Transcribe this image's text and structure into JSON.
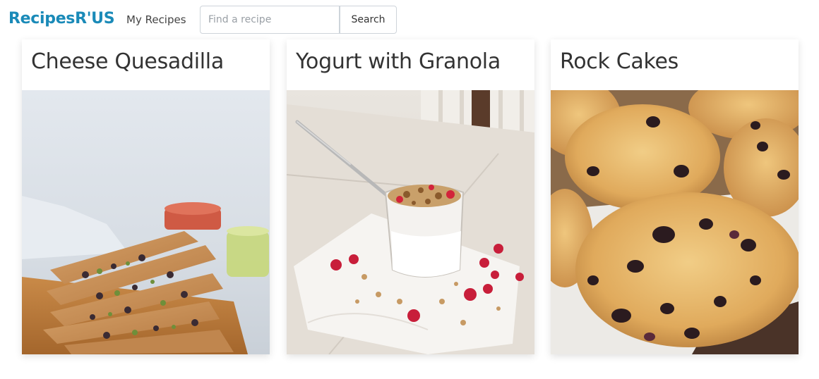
{
  "header": {
    "brand": "RecipesR'US",
    "nav_link": "My Recipes",
    "search": {
      "placeholder": "Find a recipe",
      "value": "",
      "button_label": "Search"
    }
  },
  "recipes": [
    {
      "title": "Cheese Quesadilla",
      "image": "quesadilla-photo"
    },
    {
      "title": "Yogurt with Granola",
      "image": "yogurt-granola-photo"
    },
    {
      "title": "Rock Cakes",
      "image": "rock-cakes-photo"
    }
  ],
  "colors": {
    "brand": "#1a8ab8",
    "text": "#333333",
    "border": "#ced4da"
  }
}
